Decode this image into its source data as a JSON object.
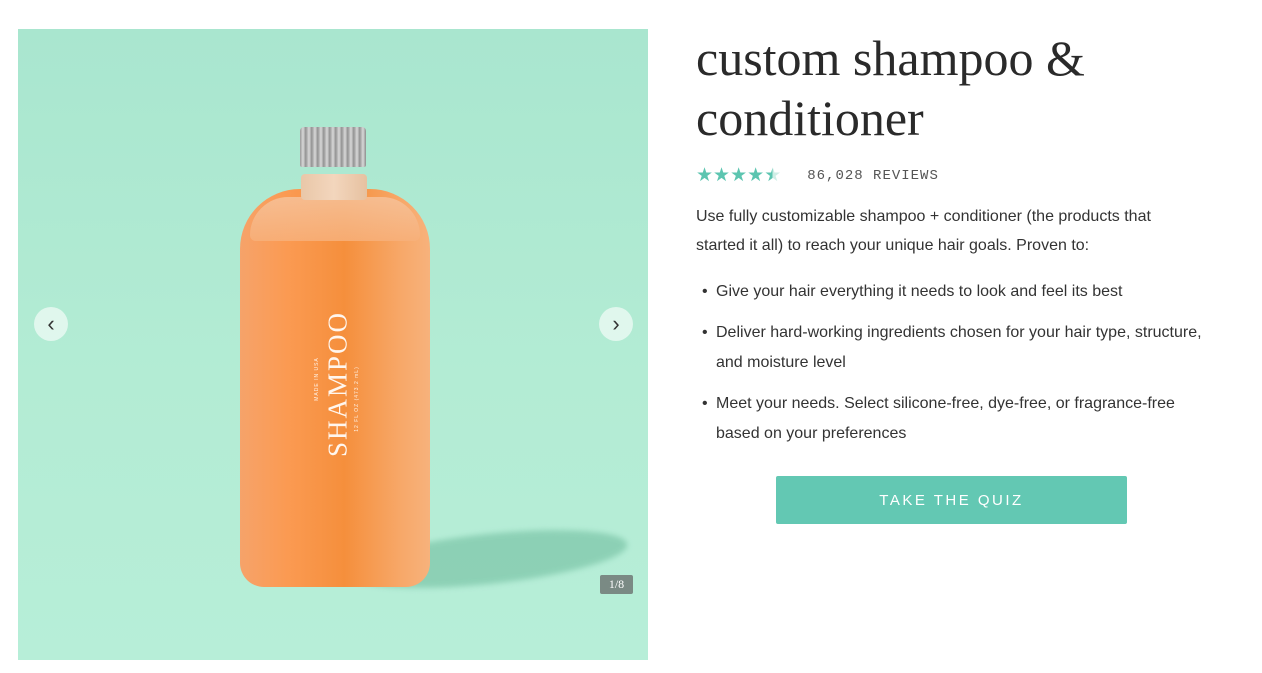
{
  "gallery": {
    "bottle_label": "SHAMPOO",
    "bottle_subtext_top": "MADE IN USA",
    "bottle_subtext_bottom": "12 FL OZ (473.2 mL)",
    "counter": "1/8",
    "prev_icon": "chevron-left-icon",
    "next_icon": "chevron-right-icon",
    "background_color": "#b1eacf"
  },
  "product": {
    "title": "custom shampoo & conditioner",
    "rating_stars": "★★★★★",
    "rating_value_fraction": 0.9,
    "reviews_text": "86,028 REVIEWS",
    "description": "Use fully customizable shampoo + conditioner (the products that started it all) to reach your unique hair goals. Proven to:",
    "benefits": [
      "Give your hair everything it needs to look and feel its best",
      "Deliver hard-working ingredients chosen for your hair type, structure, and moisture level",
      "Meet your needs. Select silicone-free, dye-free, or fragrance-free based on your preferences"
    ],
    "cta_label": "TAKE THE QUIZ",
    "accent_color": "#63c8b3"
  }
}
